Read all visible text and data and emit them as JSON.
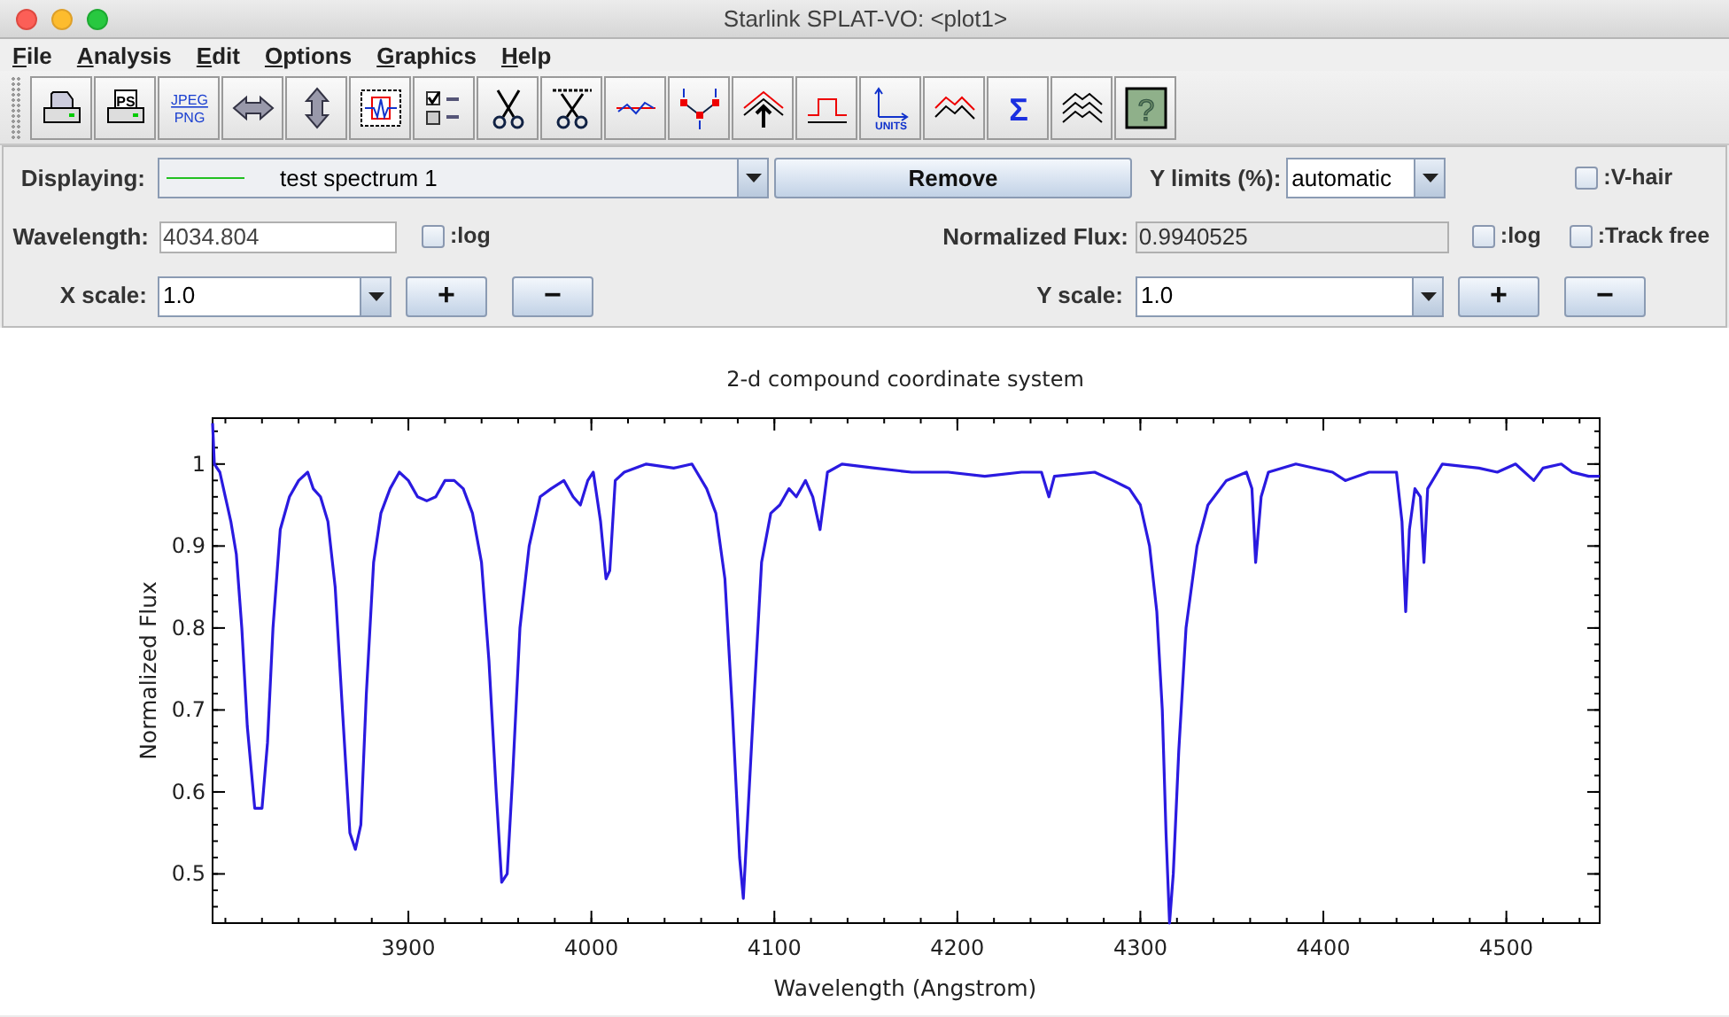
{
  "window": {
    "title": "Starlink SPLAT-VO: <plot1>"
  },
  "menu": [
    "File",
    "Analysis",
    "Edit",
    "Options",
    "Graphics",
    "Help"
  ],
  "toolbar": [
    {
      "kind": "print"
    },
    {
      "kind": "postscript",
      "text": "PS"
    },
    {
      "kind": "image-export",
      "text": "JPEG",
      "text2": "PNG"
    },
    {
      "kind": "horizontal-arrows"
    },
    {
      "kind": "vertical-arrows"
    },
    {
      "kind": "plot-region"
    },
    {
      "kind": "checklist"
    },
    {
      "kind": "scissors"
    },
    {
      "kind": "scissors-line"
    },
    {
      "kind": "wave-line"
    },
    {
      "kind": "points-line"
    },
    {
      "kind": "peak-arrow"
    },
    {
      "kind": "step-line"
    },
    {
      "kind": "units-axes",
      "text": "UNITS"
    },
    {
      "kind": "double-peak"
    },
    {
      "kind": "sigma",
      "text": "Σ"
    },
    {
      "kind": "stacked-peaks"
    },
    {
      "kind": "help",
      "text": "?"
    }
  ],
  "controls": {
    "displaying": {
      "label": "Displaying:",
      "value": "test spectrum 1"
    },
    "remove_button": "Remove",
    "y_limits": {
      "label": "Y limits (%):",
      "value": "automatic"
    },
    "v_hair": {
      "label": ":V-hair",
      "checked": false
    },
    "wavelength": {
      "label": "Wavelength:",
      "value": "4034.804"
    },
    "wavelength_log": {
      "label": ":log",
      "checked": false
    },
    "normalized_flux": {
      "label": "Normalized Flux:",
      "value": "0.9940525",
      "disabled": true
    },
    "flux_log": {
      "label": ":log",
      "checked": false
    },
    "track_free": {
      "label": ":Track free",
      "checked": false
    },
    "x_scale": {
      "label": "X scale:",
      "value": "1.0",
      "plus": "+",
      "minus": "−"
    },
    "y_scale": {
      "label": "Y scale:",
      "value": "1.0",
      "plus": "+",
      "minus": "−"
    }
  },
  "plot": {
    "chart_data": {
      "type": "line",
      "title": "2-d compound coordinate system",
      "xlabel": "Wavelength (Angstrom)",
      "ylabel": "Normalized Flux",
      "xlim": [
        3793,
        4551
      ],
      "ylim": [
        0.44,
        1.056
      ],
      "xticks": [
        3900,
        4000,
        4100,
        4200,
        4300,
        4400,
        4500
      ],
      "yticks": [
        {
          "value": 0.5,
          "label": "0.5"
        },
        {
          "value": 0.6,
          "label": "0.6"
        },
        {
          "value": 0.7,
          "label": "0.7"
        },
        {
          "value": 0.8,
          "label": "0.8"
        },
        {
          "value": 0.9,
          "label": "0.9"
        },
        {
          "value": 1,
          "label": "1"
        }
      ],
      "x": [
        3793,
        3794,
        3797,
        3800,
        3803,
        3806,
        3809,
        3812,
        3816,
        3820,
        3823,
        3826,
        3830,
        3835,
        3840,
        3845,
        3848,
        3852,
        3856,
        3860,
        3864,
        3868,
        3871,
        3874,
        3877,
        3881,
        3885,
        3890,
        3895,
        3900,
        3905,
        3910,
        3915,
        3920,
        3925,
        3930,
        3935,
        3940,
        3944,
        3948,
        3951,
        3954,
        3957,
        3961,
        3966,
        3972,
        3978,
        3985,
        3990,
        3994,
        3998,
        4001,
        4005,
        4008,
        4010,
        4013,
        4018,
        4030,
        4045,
        4055,
        4063,
        4068,
        4073,
        4077,
        4081,
        4083,
        4085,
        4089,
        4093,
        4098,
        4103,
        4108,
        4112,
        4117,
        4121,
        4125,
        4129,
        4137,
        4155,
        4175,
        4195,
        4215,
        4235,
        4246,
        4250,
        4253,
        4275,
        4285,
        4294,
        4300,
        4305,
        4309,
        4312,
        4314,
        4316,
        4318,
        4321,
        4325,
        4331,
        4337,
        4347,
        4358,
        4361,
        4363,
        4366,
        4370,
        4385,
        4405,
        4412,
        4425,
        4440,
        4443,
        4445,
        4447,
        4450,
        4453,
        4455,
        4457,
        4465,
        4485,
        4495,
        4505,
        4515,
        4520,
        4530,
        4536,
        4545,
        4551
      ],
      "series": [
        {
          "color": "#2a1ae0",
          "values": [
            1.05,
            1.0,
            0.99,
            0.96,
            0.93,
            0.89,
            0.8,
            0.68,
            0.58,
            0.58,
            0.66,
            0.8,
            0.92,
            0.96,
            0.98,
            0.99,
            0.97,
            0.96,
            0.93,
            0.85,
            0.7,
            0.55,
            0.53,
            0.56,
            0.72,
            0.88,
            0.94,
            0.97,
            0.99,
            0.98,
            0.96,
            0.955,
            0.96,
            0.98,
            0.98,
            0.97,
            0.94,
            0.88,
            0.76,
            0.6,
            0.49,
            0.5,
            0.62,
            0.8,
            0.9,
            0.96,
            0.97,
            0.98,
            0.96,
            0.95,
            0.98,
            0.99,
            0.93,
            0.86,
            0.87,
            0.98,
            0.99,
            1.0,
            0.995,
            1.0,
            0.97,
            0.94,
            0.86,
            0.7,
            0.52,
            0.47,
            0.55,
            0.72,
            0.88,
            0.94,
            0.95,
            0.97,
            0.96,
            0.98,
            0.96,
            0.92,
            0.99,
            1.0,
            0.995,
            0.99,
            0.99,
            0.985,
            0.99,
            0.99,
            0.96,
            0.985,
            0.99,
            0.98,
            0.97,
            0.95,
            0.9,
            0.82,
            0.7,
            0.55,
            0.44,
            0.5,
            0.65,
            0.8,
            0.9,
            0.95,
            0.98,
            0.99,
            0.97,
            0.88,
            0.96,
            0.99,
            1.0,
            0.99,
            0.98,
            0.99,
            0.99,
            0.93,
            0.82,
            0.92,
            0.97,
            0.96,
            0.88,
            0.97,
            1.0,
            0.995,
            0.99,
            1.0,
            0.98,
            0.995,
            1.0,
            0.99,
            0.985,
            0.985
          ]
        }
      ]
    }
  }
}
